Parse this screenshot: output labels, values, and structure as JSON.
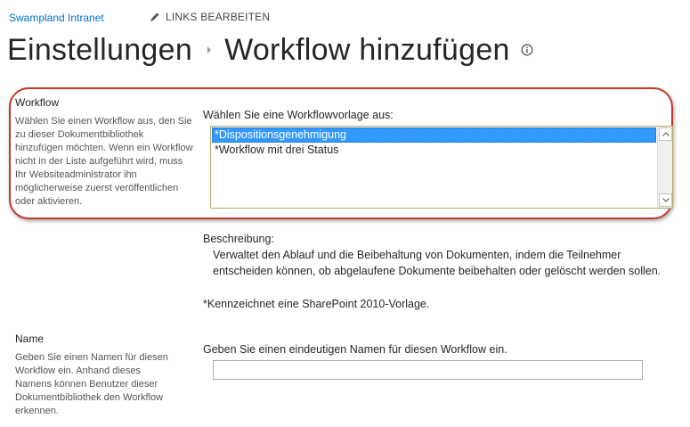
{
  "header": {
    "site_name": "Swampland Intranet",
    "edit_links_label": "LINKS BEARBEITEN",
    "edit_icon": "pencil-icon"
  },
  "title": {
    "parent": "Einstellungen",
    "current": "Workflow hinzufügen",
    "separator_icon": "chevron-right-icon",
    "info_icon": "info-icon"
  },
  "workflow_section": {
    "title": "Workflow",
    "description": "Wählen Sie einen Workflow aus, den Sie zu dieser Dokumentbibliothek hinzufügen möchten. Wenn ein Workflow nicht in der Liste aufgeführt wird, muss Ihr Websiteadministrator ihn möglicherweise zuerst veröffentlichen oder aktivieren.",
    "field_label": "Wählen Sie eine Workflowvorlage aus:",
    "templates": [
      {
        "label": "*Dispositionsgenehmigung",
        "selected": true
      },
      {
        "label": "*Workflow mit drei Status",
        "selected": false
      }
    ],
    "highlight_color": "#c0392b"
  },
  "description_block": {
    "label": "Beschreibung:",
    "text": "Verwaltet den Ablauf und die Beibehaltung von Dokumenten, indem die Teilnehmer entscheiden können, ob abgelaufene Dokumente beibehalten oder gelöscht werden sollen.",
    "note": "*Kennzeichnet eine SharePoint 2010-Vorlage."
  },
  "name_section": {
    "title": "Name",
    "description": "Geben Sie einen Namen für diesen Workflow ein. Anhand dieses Namens können Benutzer dieser Dokumentbibliothek den Workflow erkennen.",
    "field_label": "Geben Sie einen eindeutigen Namen für diesen Workflow ein.",
    "value": "",
    "placeholder": ""
  },
  "colors": {
    "link": "#0072c6",
    "selection": "#3399ff"
  }
}
